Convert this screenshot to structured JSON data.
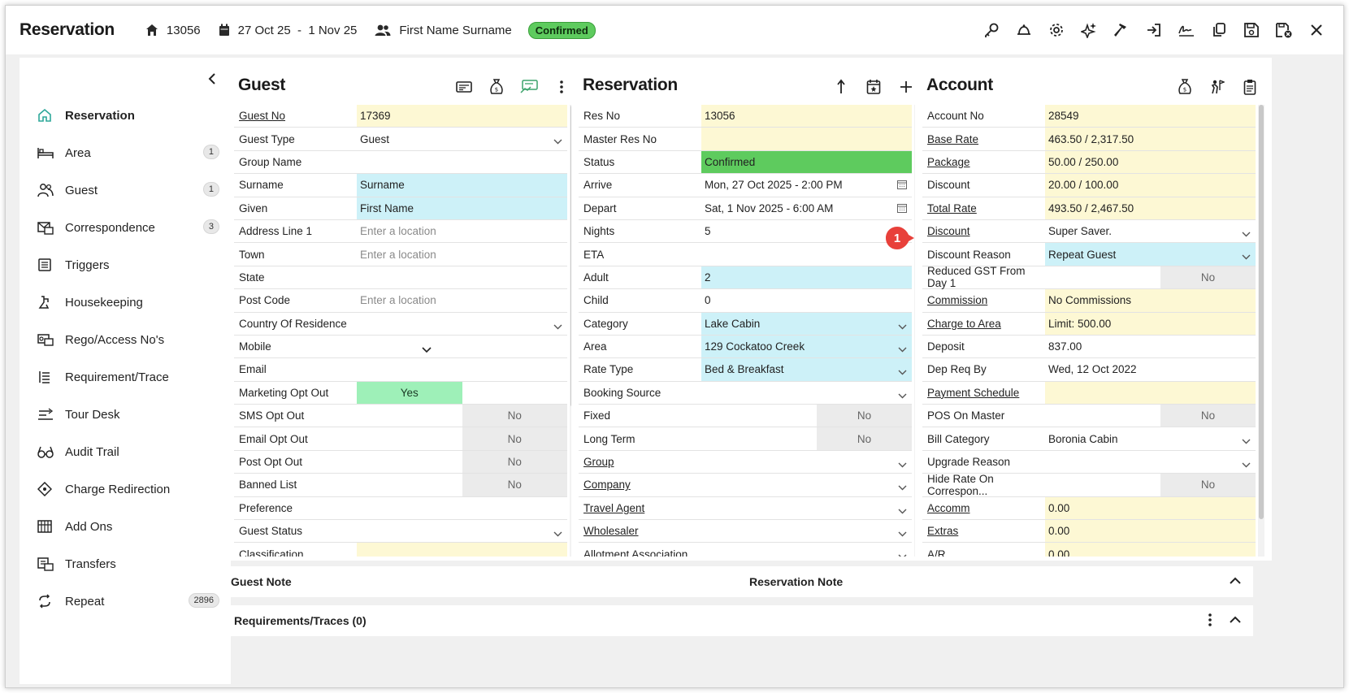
{
  "header": {
    "title": "Reservation",
    "res_no": "13056",
    "dates": "27 Oct 25  -  1 Nov 25",
    "guest_name": "First Name Surname",
    "status": "Confirmed"
  },
  "toolbar": {
    "icons": [
      "key-icon",
      "bell-icon",
      "gear-icon",
      "sparkle-icon",
      "hammer-icon",
      "check-in-icon",
      "signature-icon",
      "copy-icon",
      "save-icon",
      "save-close-icon",
      "close-icon"
    ]
  },
  "sidebar": {
    "items": [
      {
        "label": "Reservation",
        "count": ""
      },
      {
        "label": "Area",
        "count": "1"
      },
      {
        "label": "Guest",
        "count": "1"
      },
      {
        "label": "Correspondence",
        "count": "3"
      },
      {
        "label": "Triggers",
        "count": ""
      },
      {
        "label": "Housekeeping",
        "count": ""
      },
      {
        "label": "Rego/Access No's",
        "count": ""
      },
      {
        "label": "Requirement/Trace",
        "count": ""
      },
      {
        "label": "Tour Desk",
        "count": ""
      },
      {
        "label": "Audit Trail",
        "count": ""
      },
      {
        "label": "Charge Redirection",
        "count": ""
      },
      {
        "label": "Add Ons",
        "count": ""
      },
      {
        "label": "Transfers",
        "count": ""
      },
      {
        "label": "Repeat",
        "count": "2896"
      }
    ]
  },
  "guest": {
    "title": "Guest",
    "rows": [
      {
        "k": "Guest No",
        "v": "17369"
      },
      {
        "k": "Guest Type",
        "v": "Guest"
      },
      {
        "k": "Group Name",
        "v": ""
      },
      {
        "k": "Surname",
        "v": "Surname"
      },
      {
        "k": "Given",
        "v": "First Name"
      },
      {
        "k": "Address Line 1",
        "v": "Enter a location"
      },
      {
        "k": "Town",
        "v": "Enter a location"
      },
      {
        "k": "State",
        "v": ""
      },
      {
        "k": "Post Code",
        "v": "Enter a location"
      },
      {
        "k": "Country Of Residence",
        "v": ""
      },
      {
        "k": "Mobile",
        "v": ""
      },
      {
        "k": "Email",
        "v": ""
      },
      {
        "k": "Marketing Opt Out",
        "v": "Yes"
      },
      {
        "k": "SMS Opt Out",
        "v": "No"
      },
      {
        "k": "Email Opt Out",
        "v": "No"
      },
      {
        "k": "Post Opt Out",
        "v": "No"
      },
      {
        "k": "Banned List",
        "v": "No"
      },
      {
        "k": "Preference",
        "v": ""
      },
      {
        "k": "Guest Status",
        "v": ""
      },
      {
        "k": "Classification",
        "v": ""
      }
    ]
  },
  "reservation": {
    "title": "Reservation",
    "rows": [
      {
        "k": "Res No",
        "v": "13056"
      },
      {
        "k": "Master Res No",
        "v": ""
      },
      {
        "k": "Status",
        "v": "Confirmed"
      },
      {
        "k": "Arrive",
        "v": "Mon, 27 Oct 2025 - 2:00 PM"
      },
      {
        "k": "Depart",
        "v": "Sat, 1 Nov 2025 - 6:00 AM"
      },
      {
        "k": "Nights",
        "v": "5"
      },
      {
        "k": "ETA",
        "v": ""
      },
      {
        "k": "Adult",
        "v": "2"
      },
      {
        "k": "Child",
        "v": "0"
      },
      {
        "k": "Category",
        "v": "Lake Cabin"
      },
      {
        "k": "Area",
        "v": "129 Cockatoo Creek"
      },
      {
        "k": "Rate Type",
        "v": "Bed & Breakfast"
      },
      {
        "k": "Booking Source",
        "v": ""
      },
      {
        "k": "Fixed",
        "v": "No"
      },
      {
        "k": "Long Term",
        "v": "No"
      },
      {
        "k": "Group",
        "v": ""
      },
      {
        "k": "Company",
        "v": ""
      },
      {
        "k": "Travel Agent",
        "v": ""
      },
      {
        "k": "Wholesaler",
        "v": ""
      },
      {
        "k": "Allotment Association",
        "v": ""
      }
    ]
  },
  "account": {
    "title": "Account",
    "rows": [
      {
        "k": "Account No",
        "v": "28549"
      },
      {
        "k": "Base Rate",
        "v": "463.50 / 2,317.50"
      },
      {
        "k": "Package",
        "v": "50.00 / 250.00"
      },
      {
        "k": "Discount",
        "v": "20.00 / 100.00"
      },
      {
        "k": "Total Rate",
        "v": "493.50 / 2,467.50"
      },
      {
        "k": "Discount",
        "v": "Super Saver."
      },
      {
        "k": "Discount Reason",
        "v": "Repeat Guest"
      },
      {
        "k": "Reduced GST From Day 1",
        "v": "No"
      },
      {
        "k": "Commission",
        "v": "No Commissions"
      },
      {
        "k": "Charge to Area",
        "v": "Limit: 500.00"
      },
      {
        "k": "Deposit",
        "v": "837.00"
      },
      {
        "k": "Dep Req By",
        "v": "Wed, 12 Oct 2022"
      },
      {
        "k": "Payment Schedule",
        "v": ""
      },
      {
        "k": "POS On Master",
        "v": "No"
      },
      {
        "k": "Bill Category",
        "v": "Boronia Cabin"
      },
      {
        "k": "Upgrade Reason",
        "v": ""
      },
      {
        "k": "Hide Rate On Correspon...",
        "v": "No"
      },
      {
        "k": "Accomm",
        "v": "0.00"
      },
      {
        "k": "Extras",
        "v": "0.00"
      },
      {
        "k": "A/R",
        "v": "0.00"
      }
    ]
  },
  "notes": {
    "guest_note": "Guest Note",
    "reservation_note": "Reservation Note"
  },
  "traces": {
    "label": "Requirements/Traces (0)"
  },
  "callout": {
    "number": "1",
    "color": "#e8403a"
  }
}
